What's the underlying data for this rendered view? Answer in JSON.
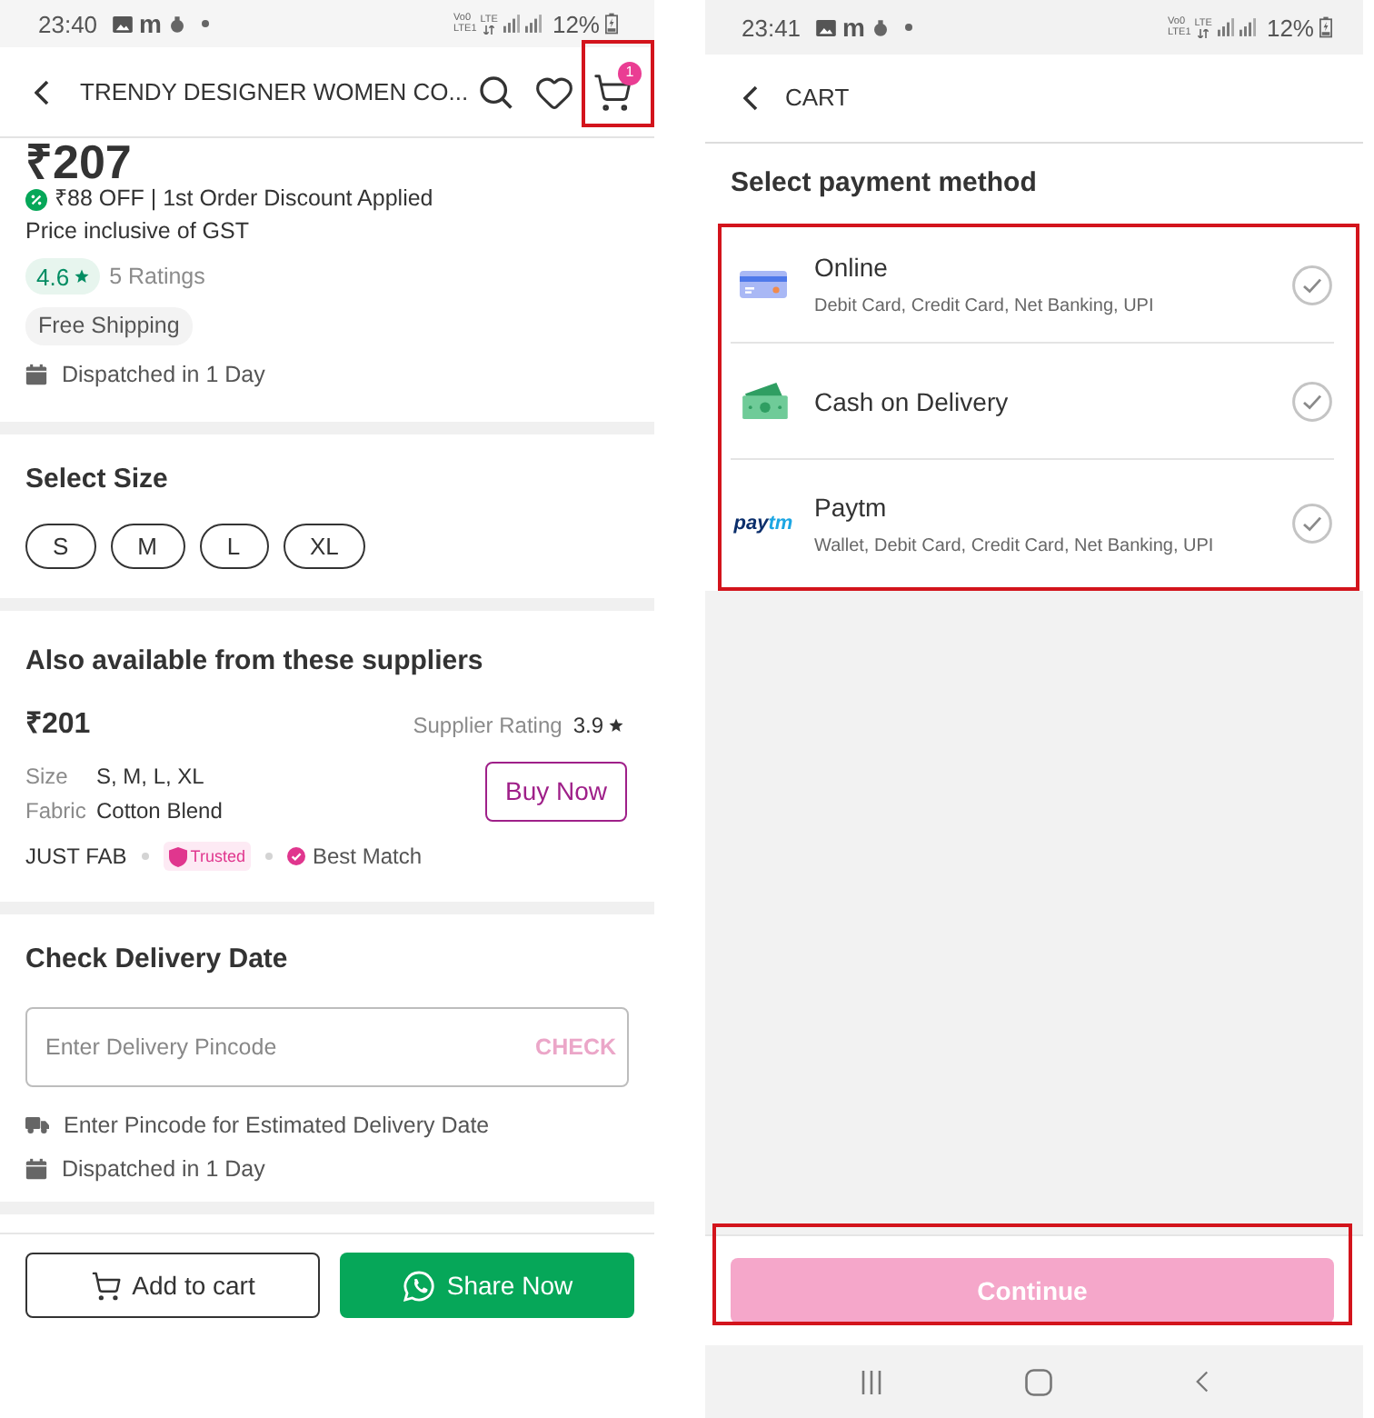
{
  "left_screen": {
    "status_bar": {
      "time": "23:40",
      "app_label": "m",
      "network": [
        "Vo0",
        "LTE1"
      ],
      "data_label": "LTE",
      "battery": "12%"
    },
    "header": {
      "title": "TRENDY DESIGNER WOMEN CO...",
      "cart_count": "1",
      "cart_highlighted": true
    },
    "price": "₹207",
    "discount": "₹88 OFF | 1st Order Discount Applied",
    "tax_note": "Price inclusive of GST",
    "rating": {
      "score": "4.6",
      "count": "5 Ratings"
    },
    "shipping_tag": "Free Shipping",
    "dispatch": "Dispatched in 1 Day",
    "size_section": {
      "title": "Select Size",
      "sizes": [
        {
          "label": "S",
          "selected": false
        },
        {
          "label": "M",
          "selected": false
        },
        {
          "label": "L",
          "selected": false
        },
        {
          "label": "XL",
          "selected": false
        }
      ]
    },
    "suppliers": {
      "title": "Also available from these suppliers",
      "price": "₹201",
      "rating_label": "Supplier Rating",
      "rating": "3.9",
      "details": [
        {
          "label": "Size",
          "value": "S, M, L, XL"
        },
        {
          "label": "Fabric",
          "value": "Cotton Blend"
        }
      ],
      "buy_button": "Buy Now",
      "supplier_name": "JUST FAB",
      "trusted_badge": "Trusted",
      "match_tag": "Best Match"
    },
    "delivery": {
      "title": "Check Delivery Date",
      "pincode_field": {
        "placeholder": "Enter Delivery Pincode"
      },
      "check_button": "CHECK",
      "notes": [
        "Enter Pincode for Estimated Delivery Date",
        "Dispatched in 1 Day"
      ]
    },
    "actions": [
      {
        "kind": "outline",
        "label": "Add to cart"
      },
      {
        "kind": "solid",
        "label": "Share Now"
      }
    ]
  },
  "right_screen": {
    "status_bar": {
      "time": "23:41",
      "app_label": "m",
      "network": [
        "Vo0",
        "LTE1"
      ],
      "data_label": "LTE",
      "battery": "12%"
    },
    "header": {
      "title": "CART"
    },
    "section_title": "Select payment method",
    "payment_highlighted": true,
    "payment_options": [
      {
        "kind": "icon",
        "title": "Online",
        "subtitle": "Debit Card, Credit Card, Net Banking, UPI",
        "selected": false
      },
      {
        "kind": "icon",
        "title": "Cash on Delivery",
        "selected": false
      },
      {
        "kind": "logo",
        "logo": [
          "pay",
          "tm"
        ],
        "title": "Paytm",
        "subtitle": "Wallet, Debit Card, Credit Card, Net Banking, UPI",
        "selected": false
      }
    ],
    "continue_button": {
      "label": "Continue",
      "disabled": true,
      "highlighted": true
    }
  }
}
